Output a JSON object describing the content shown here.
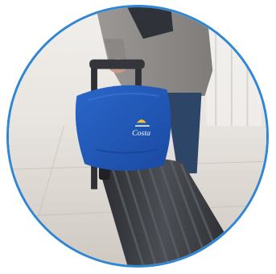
{
  "photo": {
    "subject": "traveller-pulling-suitcase-with-pillow",
    "pillow_logo_text": "Costa",
    "colors": {
      "frame_border": "#2f86d4",
      "pillow": "#1f57b8",
      "suitcase": "#3d3f44",
      "coat": "#8e8b88",
      "jeans": "#2d4668",
      "floor": "#dcd8d3"
    }
  }
}
